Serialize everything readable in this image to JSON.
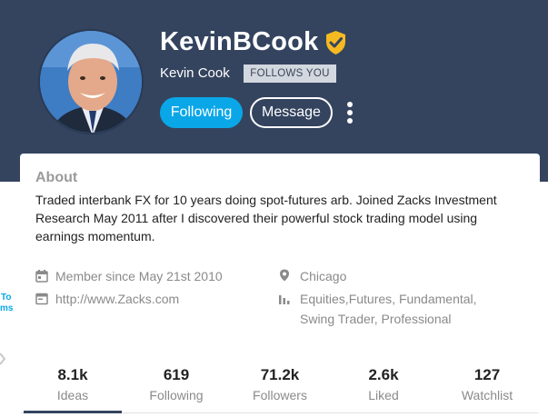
{
  "profile": {
    "username": "KevinBCook",
    "real_name": "Kevin Cook",
    "follows_badge": "FOLLOWS YOU",
    "following_button": "Following",
    "message_button": "Message"
  },
  "about": {
    "title": "About",
    "bio": "Traded interbank FX for 10 years doing spot-futures arb. Joined Zacks Investment Research May 2011 after I discovered their powerful stock trading model using earnings momentum.",
    "member_since": "Member since May 21st 2010",
    "website": "http://www.Zacks.com",
    "location": "Chicago",
    "interests_line1": "Equities,Futures, Fundamental,",
    "interests_line2": "Swing Trader, Professional"
  },
  "side": {
    "line1": "To",
    "line2": "ms"
  },
  "stats": [
    {
      "value": "8.1k",
      "label": "Ideas"
    },
    {
      "value": "619",
      "label": "Following"
    },
    {
      "value": "71.2k",
      "label": "Followers"
    },
    {
      "value": "2.6k",
      "label": "Liked"
    },
    {
      "value": "127",
      "label": "Watchlist"
    }
  ],
  "active_tab": "Ideas",
  "colors": {
    "header_bg": "#34445f",
    "accent": "#0aa7e8",
    "verified": "#f5b921"
  },
  "icons": [
    "verified-badge-icon",
    "more-vertical-icon",
    "calendar-icon",
    "browser-icon",
    "location-pin-icon",
    "bar-chart-icon"
  ]
}
